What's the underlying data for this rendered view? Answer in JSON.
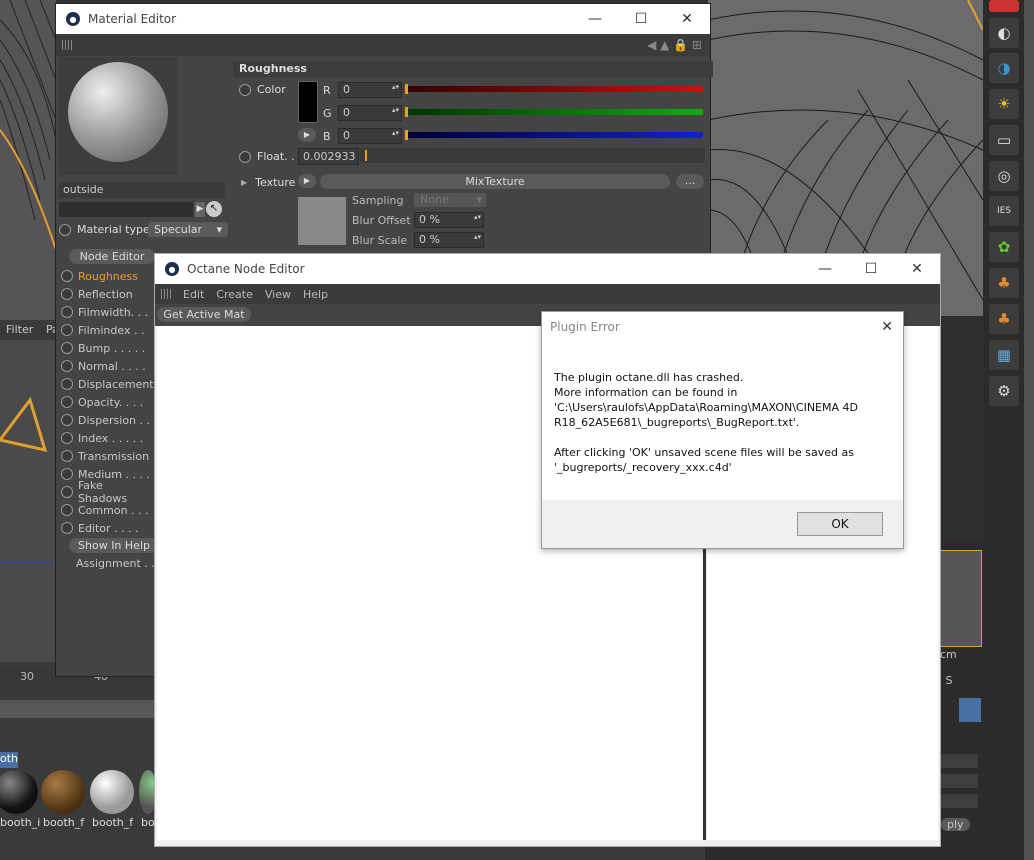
{
  "background": {
    "filter_label": "Filter",
    "filter_label2": "Pa",
    "ruler_ticks": [
      "30",
      "40"
    ],
    "material_tab": "oth",
    "materials": [
      "booth_i",
      "booth_f",
      "booth_f",
      "bo"
    ],
    "right_partial": {
      "cm": "cm",
      "fps": "3 S",
      "ply": "ply"
    }
  },
  "right_toolbar": {
    "icons": [
      "circle-half-icon",
      "circle-half-filled-icon",
      "sun-icon",
      "rectangle-light-icon",
      "target-icon",
      "ies-light-icon",
      "gear-green-icon",
      "tree-icon",
      "tree-icon",
      "film-clapper-icon",
      "settings-icon"
    ]
  },
  "material_editor": {
    "title": "Material Editor",
    "material_name": "outside",
    "material_type_label": "Material type",
    "material_type_value": "Specular",
    "node_editor_button": "Node Editor",
    "channels": [
      "Roughness",
      "Reflection",
      "Filmwidth. . .",
      "Filmindex . .",
      "Bump . . . . .",
      "Normal . . . .",
      "Displacement",
      "Opacity. . . .",
      "Dispersion . .",
      "Index . . . . .",
      "Transmission",
      "Medium . . . .",
      "Fake Shadows",
      "Common . . .",
      "Editor . . . ."
    ],
    "active_channel": "Roughness",
    "show_in_help": "Show In Help",
    "assignment": "Assignment . . .",
    "section_title": "Roughness",
    "color_label": "Color",
    "r_label": "R",
    "r_value": "0",
    "g_label": "G",
    "g_value": "0",
    "b_label": "B",
    "b_value": "0",
    "float_label": "Float. .",
    "float_value": "0.002933",
    "texture_label": "Texture",
    "texture_value": "MixTexture",
    "texture_more": "...",
    "sampling_label": "Sampling",
    "sampling_value": "None",
    "blur_offset_label": "Blur Offset",
    "blur_offset_value": "0 %",
    "blur_scale_label": "Blur Scale",
    "blur_scale_value": "0 %",
    "colors": {
      "r": "#cc1111",
      "g": "#11aa11",
      "b": "#1122cc",
      "accent": "#f0a020"
    }
  },
  "node_editor": {
    "title": "Octane Node Editor",
    "menu": [
      "Edit",
      "Create",
      "View",
      "Help"
    ],
    "get_active_mat": "Get Active Mat"
  },
  "plugin_error": {
    "title": "Plugin Error",
    "lines": [
      "The plugin octane.dll has crashed.",
      "More information can be found in",
      "'C:\\Users\\raulofs\\AppData\\Roaming\\MAXON\\CINEMA 4D",
      "R18_62A5E681\\_bugreports\\_BugReport.txt'.",
      "",
      "After clicking 'OK' unsaved scene files will be saved as",
      "'_bugreports/_recovery_xxx.c4d'"
    ],
    "ok_button": "OK"
  }
}
